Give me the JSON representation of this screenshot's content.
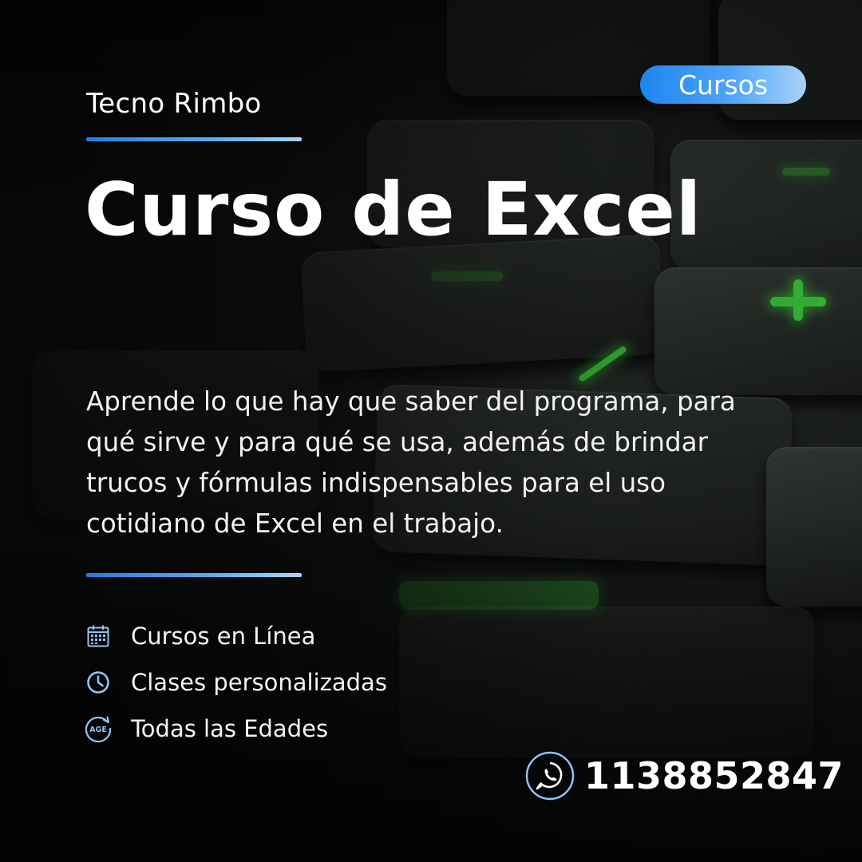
{
  "brand": "Tecno Rimbo",
  "badge": "Cursos",
  "title": "Curso de Excel",
  "description": "Aprende lo que hay que saber del programa, para qué sirve y para qué se usa, además de brindar trucos y fórmulas indispensables para el uso cotidiano de Excel en el trabajo.",
  "features": [
    {
      "icon": "calendar-icon",
      "label": "Cursos en Línea"
    },
    {
      "icon": "clock-icon",
      "label": "Clases personalizadas"
    },
    {
      "icon": "age-icon",
      "label": "Todas las Edades"
    }
  ],
  "contact": {
    "icon": "whatsapp-icon",
    "phone": "1138852847"
  },
  "colors": {
    "accent": "#1f7fe0",
    "accent_light": "#a9d6ff",
    "icon": "#8ec5f5",
    "key_glow": "#3fd83f",
    "background": "#0b0d0c",
    "text": "#ffffff"
  }
}
